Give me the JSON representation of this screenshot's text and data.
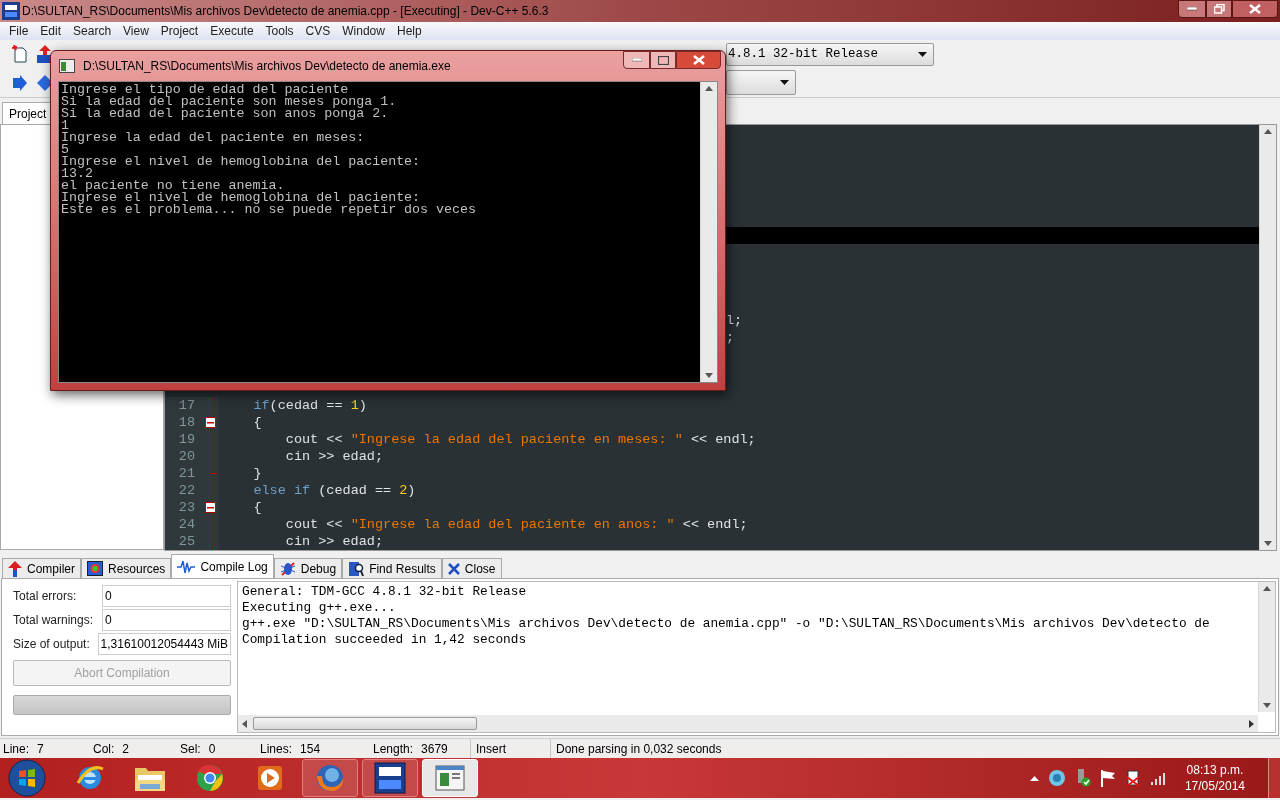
{
  "window": {
    "title": "D:\\SULTAN_RS\\Documents\\Mis archivos Dev\\detecto de anemia.cpp - [Executing] - Dev-C++ 5.6.3"
  },
  "menu": [
    "File",
    "Edit",
    "Search",
    "View",
    "Project",
    "Execute",
    "Tools",
    "CVS",
    "Window",
    "Help"
  ],
  "toolbar": {
    "compiler_select": "4.8.1 32-bit Release"
  },
  "left_panel": {
    "tabs": [
      {
        "label": "Project",
        "selected": true
      }
    ]
  },
  "editor": {
    "tails": [
      "l;",
      ";"
    ],
    "lines": [
      {
        "number": "17",
        "fold_open": false,
        "fold_end": false,
        "segments": [
          {
            "kind": "keyword",
            "text": "    if"
          },
          {
            "kind": "plain",
            "text": "(cedad == "
          },
          {
            "kind": "number",
            "text": "1"
          },
          {
            "kind": "plain",
            "text": ")"
          }
        ]
      },
      {
        "number": "18",
        "fold_open": true,
        "fold_end": false,
        "segments": [
          {
            "kind": "plain",
            "text": "    {"
          }
        ]
      },
      {
        "number": "19",
        "fold_open": false,
        "fold_end": false,
        "segments": [
          {
            "kind": "plain",
            "text": "        cout << "
          },
          {
            "kind": "string",
            "text": "\"Ingrese la edad del paciente en meses: \""
          },
          {
            "kind": "plain",
            "text": " << endl;"
          }
        ]
      },
      {
        "number": "20",
        "fold_open": false,
        "fold_end": false,
        "segments": [
          {
            "kind": "plain",
            "text": "        cin >> edad;"
          }
        ]
      },
      {
        "number": "21",
        "fold_open": false,
        "fold_end": true,
        "segments": [
          {
            "kind": "plain",
            "text": "    }"
          }
        ]
      },
      {
        "number": "22",
        "fold_open": false,
        "fold_end": false,
        "segments": [
          {
            "kind": "keyword",
            "text": "    else if"
          },
          {
            "kind": "plain",
            "text": " (cedad == "
          },
          {
            "kind": "number",
            "text": "2"
          },
          {
            "kind": "plain",
            "text": ")"
          }
        ]
      },
      {
        "number": "23",
        "fold_open": true,
        "fold_end": false,
        "segments": [
          {
            "kind": "plain",
            "text": "    {"
          }
        ]
      },
      {
        "number": "24",
        "fold_open": false,
        "fold_end": false,
        "segments": [
          {
            "kind": "plain",
            "text": "        cout << "
          },
          {
            "kind": "string",
            "text": "\"Ingrese la edad del paciente en anos: \""
          },
          {
            "kind": "plain",
            "text": " << endl;"
          }
        ]
      },
      {
        "number": "25",
        "fold_open": false,
        "fold_end": false,
        "segments": [
          {
            "kind": "plain",
            "text": "        cin >> edad;"
          }
        ]
      }
    ]
  },
  "console": {
    "title": "D:\\SULTAN_RS\\Documents\\Mis archivos Dev\\detecto de anemia.exe",
    "lines": [
      "Ingrese el tipo de edad del paciente",
      "Si la edad del paciente son meses ponga 1.",
      "Si la edad del paciente son anos ponga 2.",
      "1",
      "Ingrese la edad del paciente en meses:",
      "5",
      "Ingrese el nivel de hemoglobina del paciente:",
      "13.2",
      "el paciente no tiene anemia.",
      "Ingrese el nivel de hemoglobina del paciente:",
      "Este es el problema... no se puede repetir dos veces"
    ]
  },
  "bottom_tabs": [
    {
      "label": "Compiler",
      "kind": "compiler",
      "selected": false
    },
    {
      "label": "Resources",
      "kind": "resources",
      "selected": false
    },
    {
      "label": "Compile Log",
      "kind": "log",
      "selected": true
    },
    {
      "label": "Debug",
      "kind": "debug",
      "selected": false
    },
    {
      "label": "Find Results",
      "kind": "find",
      "selected": false
    },
    {
      "label": "Close",
      "kind": "close",
      "selected": false
    }
  ],
  "compile_stats": [
    {
      "label": "Total errors:",
      "value": "0"
    },
    {
      "label": "Total warnings:",
      "value": "0"
    },
    {
      "label": "Size of output:",
      "value": "1,31610012054443 MiB"
    }
  ],
  "abort_button": {
    "label": "Abort Compilation",
    "disabled": true
  },
  "progress": {
    "level": 0
  },
  "log": [
    "General: TDM-GCC 4.8.1 32-bit Release",
    "Executing g++.exe...",
    "g++.exe \"D:\\SULTAN_RS\\Documents\\Mis archivos Dev\\detecto de anemia.cpp\" -o \"D:\\SULTAN_RS\\Documents\\Mis archivos Dev\\detecto de",
    "Compilation succeeded in 1,42 seconds"
  ],
  "status_bar": [
    {
      "label": "Line:",
      "value": "7"
    },
    {
      "label": "Col:",
      "value": "2"
    },
    {
      "label": "Sel:",
      "value": "0"
    },
    {
      "label": "Lines:",
      "value": "154"
    },
    {
      "label": "Length:",
      "value": "3679"
    },
    {
      "value": "Insert"
    },
    {
      "value": "Done parsing in 0,032 seconds"
    }
  ],
  "taskbar": {
    "apps": [
      {
        "kind": "ie",
        "running": false,
        "selected": false
      },
      {
        "kind": "folder",
        "running": false,
        "selected": false
      },
      {
        "kind": "chrome",
        "running": false,
        "selected": false
      },
      {
        "kind": "media",
        "running": false,
        "selected": false
      },
      {
        "kind": "firefox",
        "running": true,
        "selected": false
      },
      {
        "kind": "dev",
        "running": true,
        "selected": false
      },
      {
        "kind": "console",
        "running": true,
        "selected": true
      }
    ],
    "clock": {
      "time": "08:13 p.m.",
      "date": "17/05/2014"
    }
  }
}
